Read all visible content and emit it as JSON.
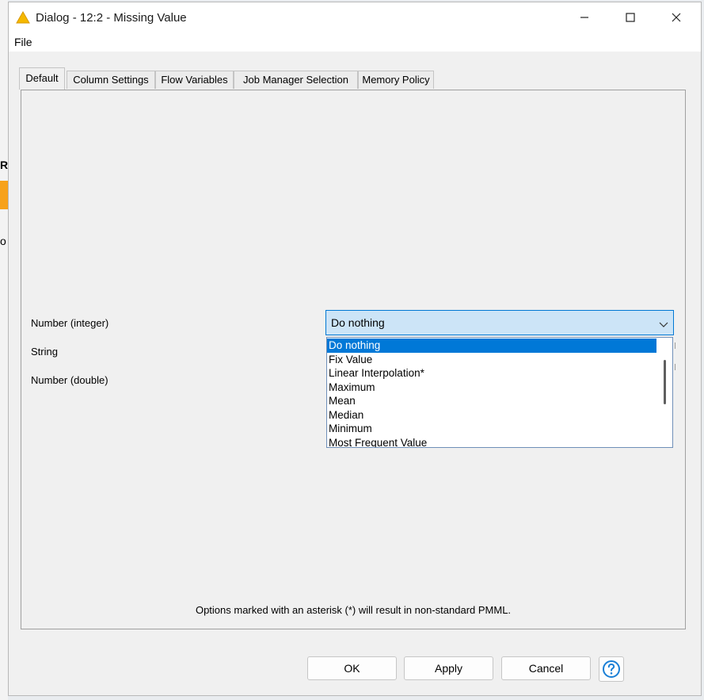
{
  "window": {
    "title": "Dialog - 12:2 - Missing Value"
  },
  "menu": {
    "file_label": "File"
  },
  "tabs": [
    {
      "label": "Default",
      "active": true
    },
    {
      "label": "Column Settings"
    },
    {
      "label": "Flow Variables"
    },
    {
      "label": "Job Manager Selection"
    },
    {
      "label": "Memory Policy"
    }
  ],
  "fields": {
    "number_integer_label": "Number (integer)",
    "string_label": "String",
    "number_double_label": "Number (double)"
  },
  "combo": {
    "selected_value": "Do nothing",
    "options": [
      "Do nothing",
      "Fix Value",
      "Linear Interpolation*",
      "Maximum",
      "Mean",
      "Median",
      "Minimum",
      "Most Frequent Value"
    ]
  },
  "footnote": "Options marked with an asterisk (*) will result in non-standard PMML.",
  "buttons": {
    "ok": "OK",
    "apply": "Apply",
    "cancel": "Cancel"
  },
  "icons": {
    "app": "warning-triangle-icon",
    "help": "help-icon",
    "accent_color": "#0078d7",
    "title_icon_color": "#f5b800"
  }
}
